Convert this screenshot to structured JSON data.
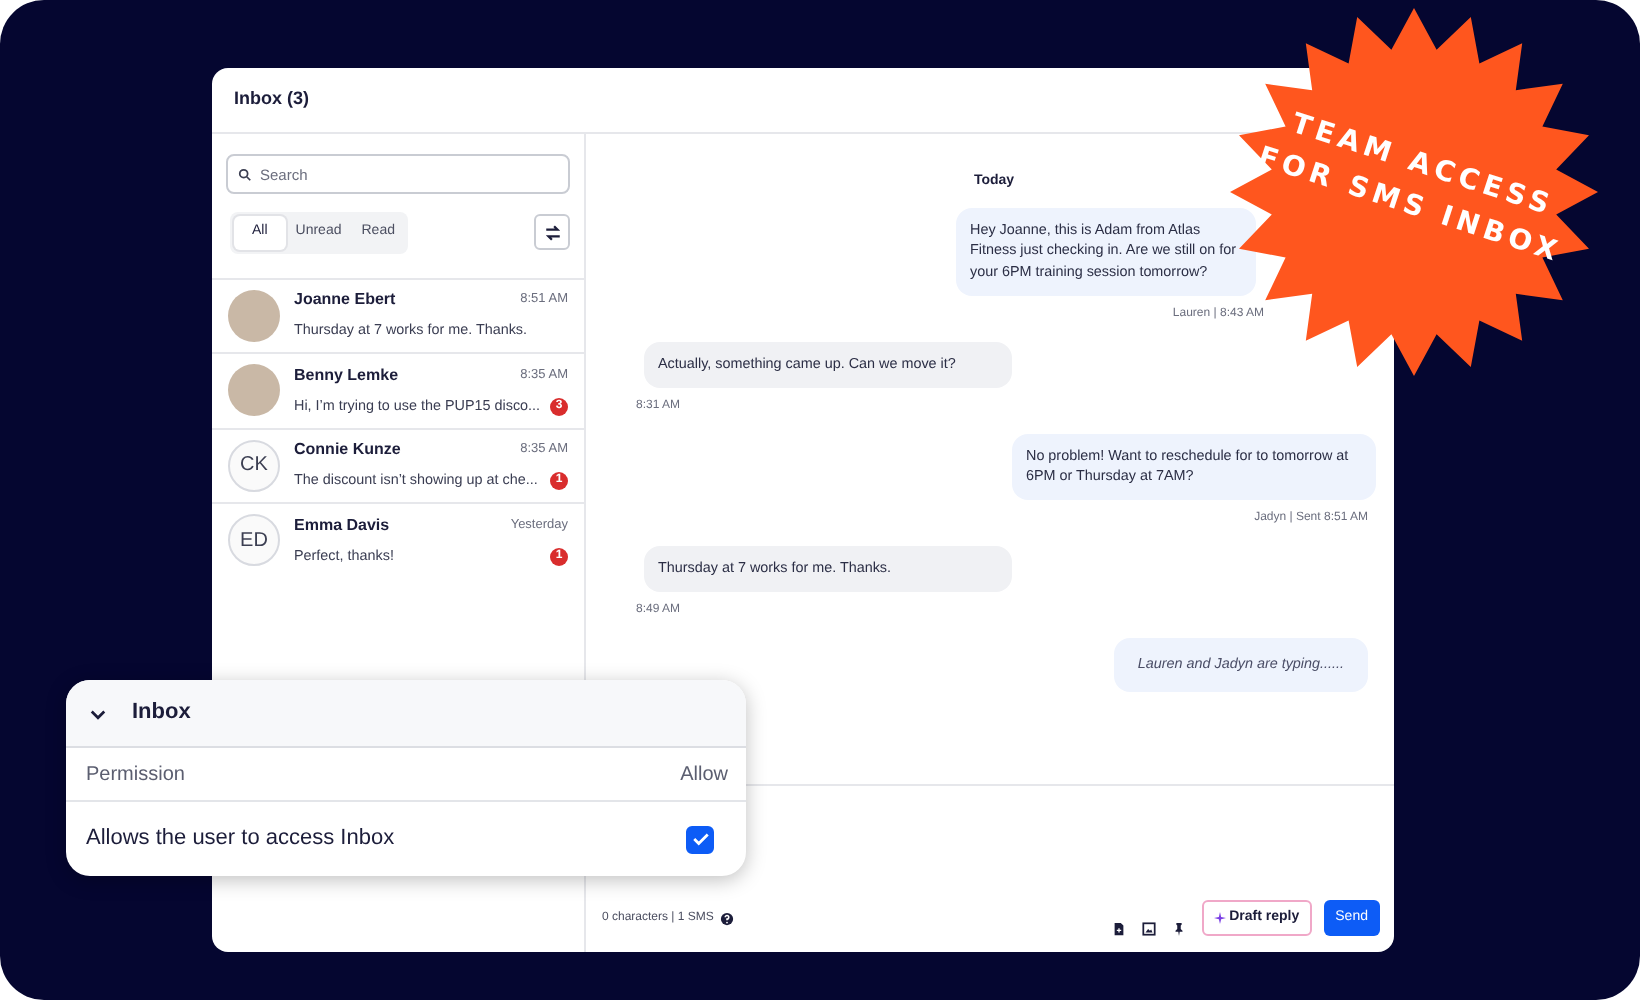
{
  "window": {
    "title": "Inbox (3)"
  },
  "search": {
    "placeholder": "Search"
  },
  "filters": [
    {
      "label": "All",
      "selected": true
    },
    {
      "label": "Unread",
      "selected": false
    },
    {
      "label": "Read",
      "selected": false
    }
  ],
  "conversations": [
    {
      "kind": "photo",
      "name": "Joanne Ebert",
      "time": "8:51 AM",
      "preview": "Thursday at 7 works for me. Thanks."
    },
    {
      "kind": "photo",
      "name": "Benny Lemke",
      "time": "8:35 AM",
      "preview": "Hi, I’m trying to use the PUP15 disco...",
      "unread": "3"
    },
    {
      "kind": "initials",
      "initials": "CK",
      "name": "Connie Kunze",
      "time": "8:35 AM",
      "preview": "The discount isn’t showing up at che...",
      "unread": "1"
    },
    {
      "kind": "initials",
      "initials": "ED",
      "name": "Emma Davis",
      "time": "Yesterday",
      "preview": "Perfect, thanks!",
      "unread": "1"
    }
  ],
  "chat": {
    "date": "Today",
    "messages": [
      {
        "kind": "outgoing",
        "text": "Hey Joanne, this is Adam from Atlas Fitness just checking in. Are we still on for your 6PM training session tomorrow?",
        "meta": "Lauren | 8:43 AM"
      },
      {
        "kind": "incoming",
        "text": "Actually, something came up. Can we move it?",
        "meta": "8:31 AM"
      },
      {
        "kind": "outgoing",
        "text": "No problem! Want to reschedule for to tomorrow at 6PM or Thursday at 7AM?",
        "meta": "Jadyn | Sent 8:51 AM"
      },
      {
        "kind": "incoming",
        "text": "Thursday at 7 works for me. Thanks.",
        "meta": "8:49 AM"
      },
      {
        "kind": "typing",
        "text": "Lauren and Jadyn are typing......"
      }
    ]
  },
  "composer": {
    "counter": "0 characters | 1 SMS",
    "draft_button": "Draft reply",
    "send_button": "Send"
  },
  "permission_panel": {
    "title": "Inbox",
    "expanded": true,
    "column_1": "Permission",
    "column_2": "Allow",
    "rows": [
      {
        "label": "Allows the user to access Inbox",
        "checked": true
      }
    ]
  },
  "badge": {
    "lines": [
      "TEAM ACCESS",
      "FOR SMS INBOX"
    ]
  }
}
